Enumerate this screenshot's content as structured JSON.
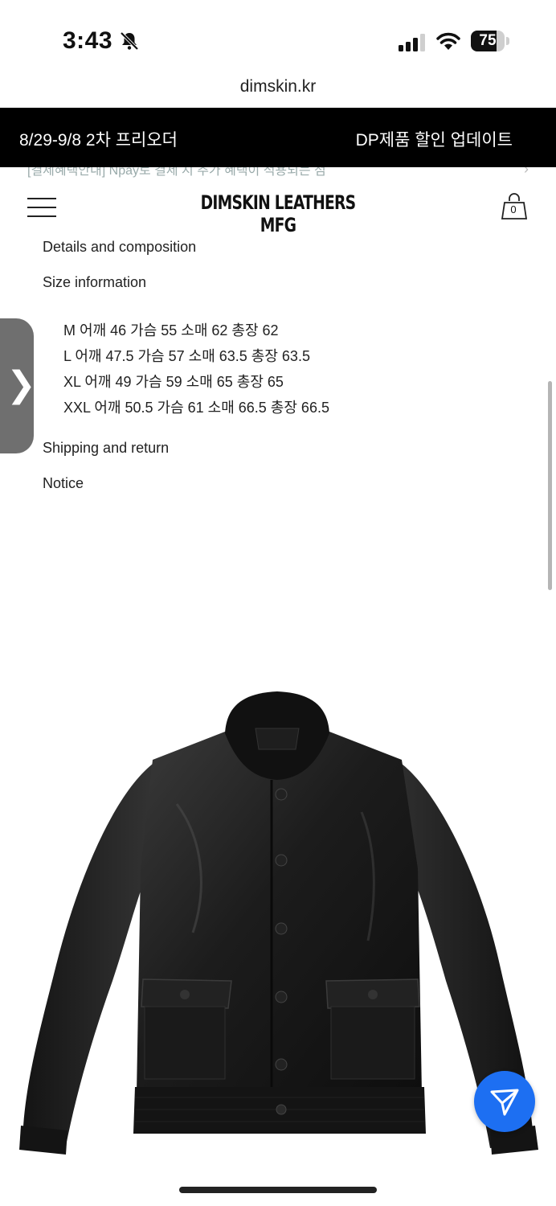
{
  "status_bar": {
    "time": "3:43",
    "battery_percent": "75",
    "battery_level": 0.75
  },
  "browser": {
    "url": "dimskin.kr"
  },
  "promo_bar": {
    "left_text": "8/29-9/8 2차 프리오더",
    "right_text": "DP제품 할인 업데이트"
  },
  "ticker": {
    "text": "[결제혜택안내] Npay로 결제 시 추가 혜택이 적용되는 점"
  },
  "header": {
    "logo": "DIMSKIN LEATHERS MFG",
    "cart_count": "0"
  },
  "accordion": {
    "details": "Details and composition",
    "size_info": "Size information",
    "shipping": "Shipping and return",
    "notice": "Notice"
  },
  "size_table": [
    "M 어깨 46 가슴 55 소매 62 총장 62",
    "L 어깨 47.5 가슴 57 소매 63.5 총장 63.5",
    "XL 어깨 49 가슴 59 소매 65 총장 65",
    "XXL 어깨 50.5 가슴 61 소매 66.5 총장 66.5"
  ],
  "side_tab": {
    "glyph": "❯"
  },
  "icons": {
    "bell": "bell-slash-icon",
    "signal": "cellular-signal-icon",
    "wifi": "wifi-icon",
    "battery": "battery-icon",
    "menu": "hamburger-menu-icon",
    "cart": "shopping-bag-icon",
    "fab": "paper-plane-icon"
  },
  "colors": {
    "promo_bg": "#000000",
    "fab_bg": "#1d6ff2",
    "side_tab_bg": "#6f6f6f"
  }
}
